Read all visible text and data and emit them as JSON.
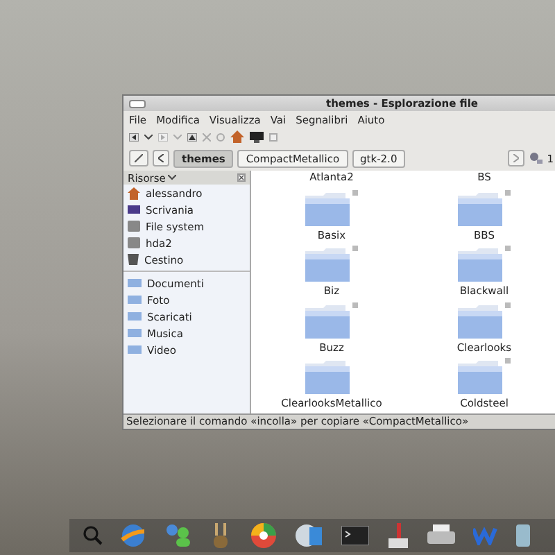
{
  "window": {
    "title": "themes - Esplorazione file"
  },
  "menu": [
    "File",
    "Modifica",
    "Visualizza",
    "Vai",
    "Segnalibri",
    "Aiuto"
  ],
  "path": [
    {
      "label": "themes",
      "selected": true
    },
    {
      "label": "CompactMetallico",
      "selected": false
    },
    {
      "label": "gtk-2.0",
      "selected": false
    }
  ],
  "zoom": "1",
  "sidebar": {
    "title": "Risorse",
    "places": [
      {
        "label": "alessandro",
        "kind": "home"
      },
      {
        "label": "Scrivania",
        "kind": "desktop"
      },
      {
        "label": "File system",
        "kind": "drive"
      },
      {
        "label": "hda2",
        "kind": "drive"
      },
      {
        "label": "Cestino",
        "kind": "trash"
      }
    ],
    "bookmarks": [
      "Documenti",
      "Foto",
      "Scaricati",
      "Musica",
      "Video"
    ]
  },
  "files": [
    {
      "name": "Atlanta2",
      "cut": true
    },
    {
      "name": "BS",
      "cut": true
    },
    {
      "name": "Basix",
      "cut": false,
      "locked": true
    },
    {
      "name": "BBS",
      "cut": false,
      "locked": true
    },
    {
      "name": "Biz",
      "cut": false,
      "locked": true
    },
    {
      "name": "Blackwall",
      "cut": false,
      "locked": true
    },
    {
      "name": "Buzz",
      "cut": false,
      "locked": true
    },
    {
      "name": "Clearlooks",
      "cut": false,
      "locked": true
    },
    {
      "name": "ClearlooksMetallico",
      "cut": false,
      "locked": false
    },
    {
      "name": "Coldsteel",
      "cut": false,
      "locked": true
    }
  ],
  "status_bar": "Selezionare il comando «incolla» per copiare «CompactMetallico»"
}
